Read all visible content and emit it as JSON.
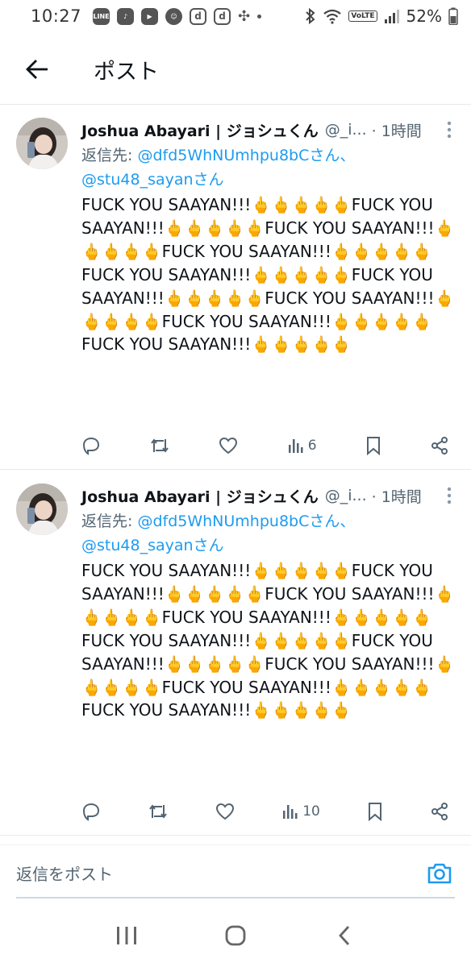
{
  "status_bar": {
    "time": "10:27",
    "apps": [
      "LINE",
      "TikTok",
      "YouTube",
      "Emoji",
      "d",
      "d",
      "Pinwheel"
    ],
    "volte": "VoLTE",
    "battery": "52%"
  },
  "header": {
    "title": "ポスト",
    "back_icon": "arrow-left-icon"
  },
  "posts": [
    {
      "author": "Joshua Abayari | ジョシュくん",
      "handle": "@_i...",
      "time": "· 1時間",
      "reply_prefix": "返信先: ",
      "reply_to_1": "@dfd5WhNUmhpu8bCさん、",
      "reply_to_2": "@stu48_sayanさん",
      "text": "FUCK YOU SAAYAN!!!🖕🖕🖕🖕🖕FUCK YOU SAAYAN!!!🖕🖕🖕🖕🖕FUCK YOU SAAYAN!!!🖕🖕🖕🖕🖕FUCK YOU SAAYAN!!!🖕🖕🖕🖕🖕FUCK YOU SAAYAN!!!🖕🖕🖕🖕🖕FUCK YOU SAAYAN!!!🖕🖕🖕🖕🖕FUCK YOU SAAYAN!!!🖕🖕🖕🖕🖕FUCK YOU SAAYAN!!!🖕🖕🖕🖕🖕FUCK YOU SAAYAN!!!🖕🖕🖕🖕🖕",
      "views": "6"
    },
    {
      "author": "Joshua Abayari | ジョシュくん",
      "handle": "@_i...",
      "time": "· 1時間",
      "reply_prefix": "返信先: ",
      "reply_to_1": "@dfd5WhNUmhpu8bCさん、",
      "reply_to_2": "@stu48_sayanさん",
      "text": "FUCK YOU SAAYAN!!!🖕🖕🖕🖕🖕FUCK YOU SAAYAN!!!🖕🖕🖕🖕🖕FUCK YOU SAAYAN!!!🖕🖕🖕🖕🖕FUCK YOU SAAYAN!!!🖕🖕🖕🖕🖕FUCK YOU SAAYAN!!!🖕🖕🖕🖕🖕FUCK YOU SAAYAN!!!🖕🖕🖕🖕🖕FUCK YOU SAAYAN!!!🖕🖕🖕🖕🖕FUCK YOU SAAYAN!!!🖕🖕🖕🖕🖕FUCK YOU SAAYAN!!!🖕🖕🖕🖕🖕",
      "views": "10"
    }
  ],
  "reply_bar": {
    "placeholder": "返信をポスト",
    "camera_icon": "camera-icon"
  },
  "colors": {
    "accent": "#1d9bf0",
    "secondary_text": "#536471",
    "primary_text": "#0f1419"
  }
}
